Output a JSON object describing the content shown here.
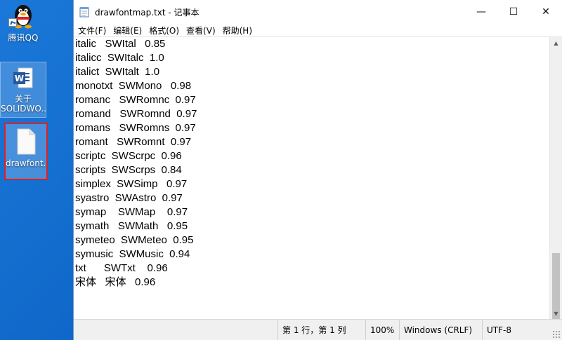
{
  "desktop": {
    "icons": [
      {
        "label": "腾讯QQ",
        "icon": "qq-penguin-icon"
      },
      {
        "label": "关于SOLIDWO...",
        "label_line1": "关于",
        "label_line2": "SOLIDWO...",
        "icon": "word-document-icon"
      },
      {
        "label": "drawfont...",
        "icon": "text-file-icon"
      }
    ]
  },
  "window": {
    "title": "drawfontmap.txt - 记事本",
    "menu": [
      "文件(F)",
      "编辑(E)",
      "格式(O)",
      "查看(V)",
      "帮助(H)"
    ],
    "controls": {
      "minimize": "—",
      "maximize": "☐",
      "close": "✕"
    }
  },
  "editor": {
    "lines": [
      "italic   SWItal   0.85",
      "italicc  SWItalc  1.0",
      "italict  SWItalt  1.0",
      "monotxt  SWMono   0.98",
      "romanc   SWRomnc  0.97",
      "romand   SWRomnd  0.97",
      "romans   SWRomns  0.97",
      "romant   SWRomnt  0.97",
      "scriptc  SWScrpc  0.96",
      "scripts  SWScrps  0.84",
      "simplex  SWSimp   0.97",
      "syastro  SWAstro  0.97",
      "symap    SWMap    0.97",
      "symath   SWMath   0.95",
      "symeteo  SWMeteo  0.95",
      "symusic  SWMusic  0.94",
      "txt      SWTxt    0.96",
      "宋体   宋体   0.96"
    ]
  },
  "statusbar": {
    "position": "第 1 行，第 1 列",
    "zoom": "100%",
    "line_ending": "Windows (CRLF)",
    "encoding": "UTF-8"
  }
}
